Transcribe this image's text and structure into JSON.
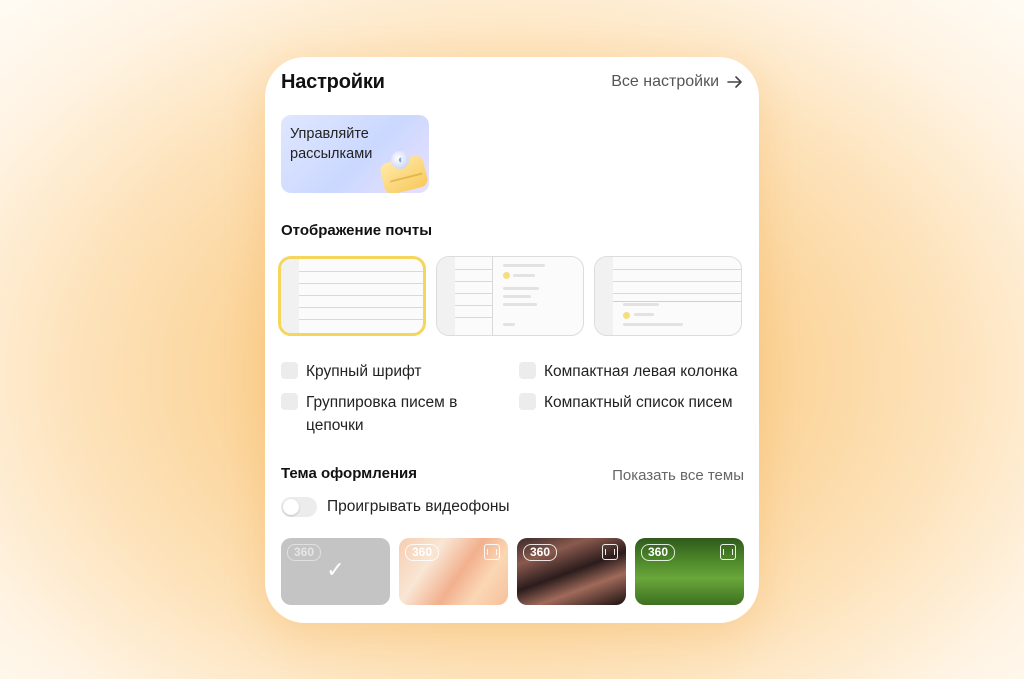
{
  "settings": {
    "title": "Настройки",
    "all_settings_label": "Все настройки",
    "promo_text": "Управляйте рассылками",
    "mail_display_title": "Отображение почты",
    "options": {
      "large_font": "Крупный шрифт",
      "grouping": "Группировка писем в цепочки",
      "compact_left_column": "Компактная левая колонка",
      "compact_list": "Компактный список писем"
    },
    "theme_title": "Тема оформления",
    "show_all_themes": "Показать все темы",
    "play_video_bg": "Проигрывать видеофоны",
    "badge": "360"
  },
  "colors": {
    "accent_yellow": "#f5d55a",
    "background": "#fbd397"
  },
  "icons": {
    "arrow": "arrow-right-icon",
    "check": "checkmark-icon",
    "film": "film-icon"
  }
}
